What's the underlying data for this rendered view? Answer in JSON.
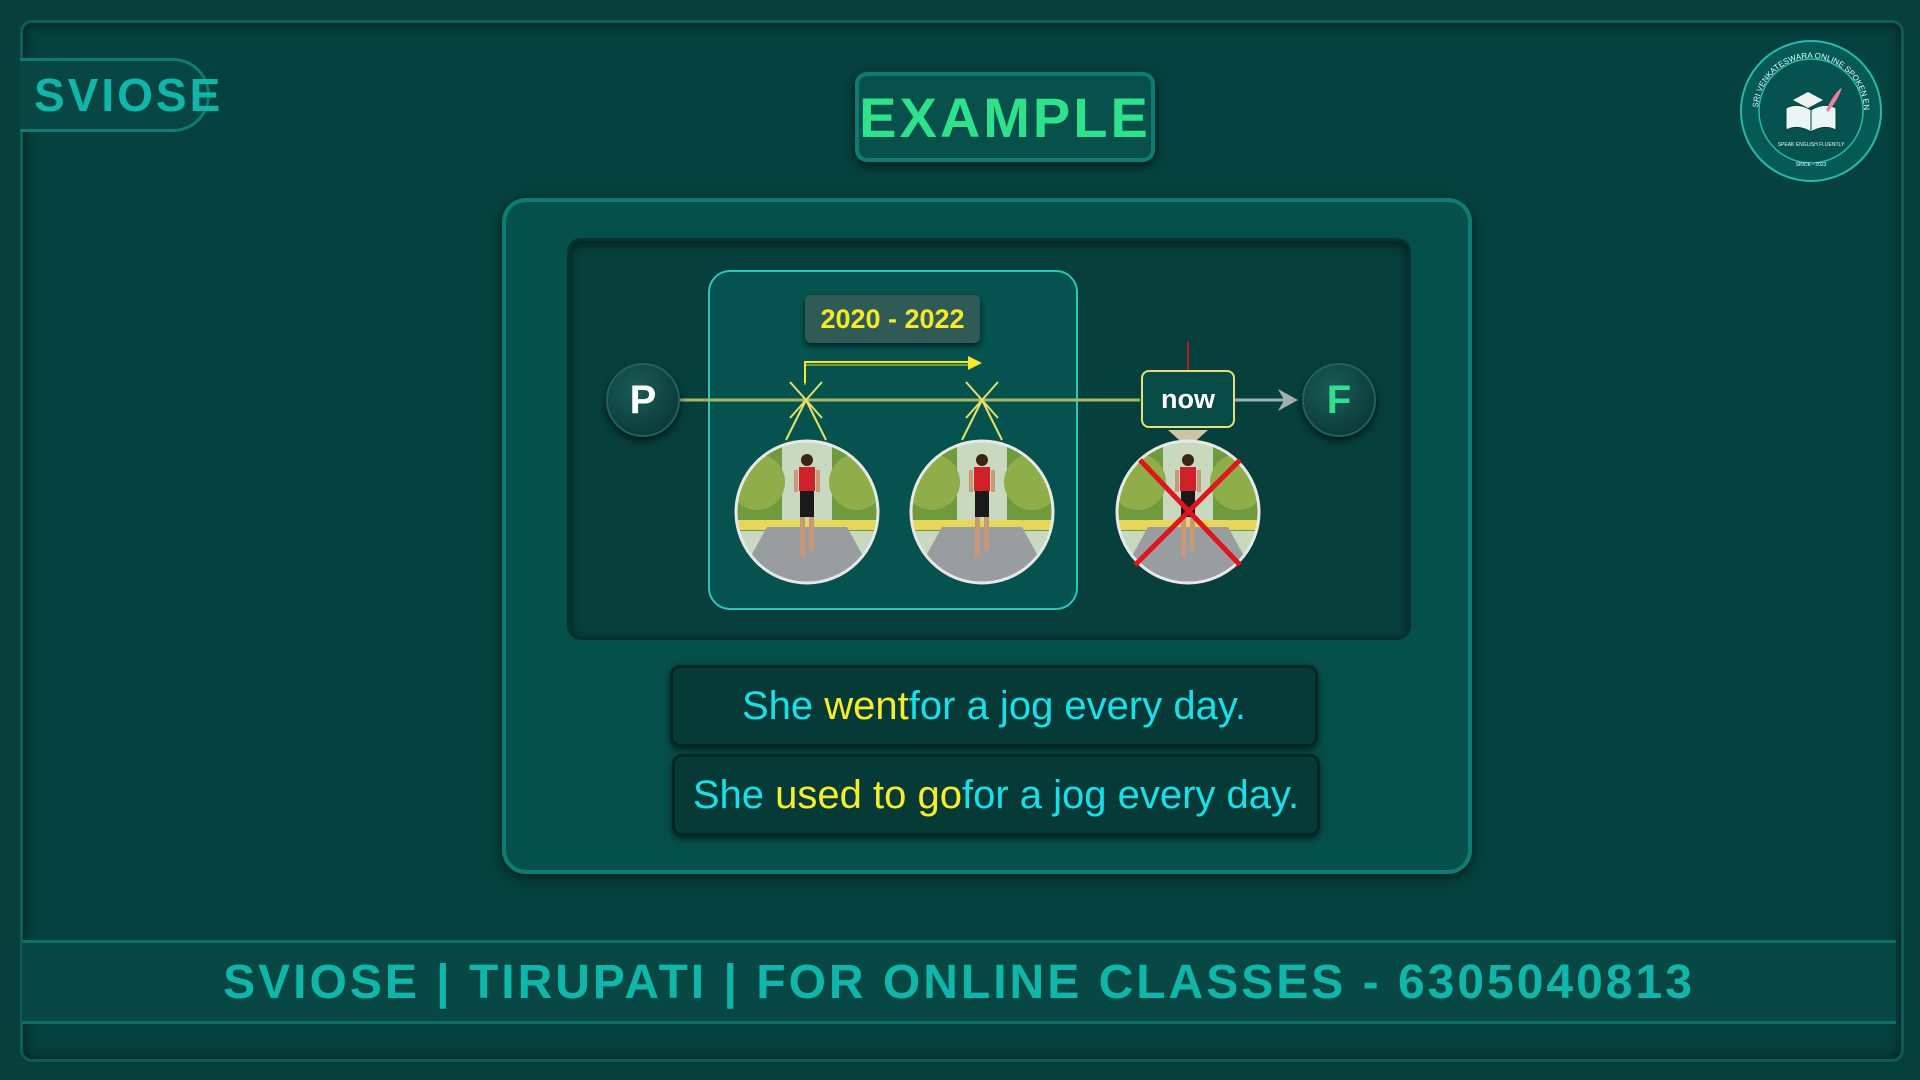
{
  "brand": {
    "tab_label": "SVIOSE"
  },
  "slide": {
    "title": "EXAMPLE"
  },
  "logo": {
    "ring_text": "SRI VENKATESWARA ONLINE SPOKEN ENGLISH SCHOOL",
    "motto": "SPEAK ENGLISH FLUENTLY",
    "since": "SINCE - 2023"
  },
  "timeline": {
    "start_label": "P",
    "end_label": "F",
    "range_label": "2020 - 2022",
    "now_label": "now"
  },
  "sentences": {
    "first": {
      "part1": "She ",
      "highlight": "went",
      "part2": " for a jog every day."
    },
    "second": {
      "part1": "She ",
      "highlight": "used to go",
      "part2": " for a jog every day."
    }
  },
  "footer": {
    "text": "SVIOSE | TIRUPATI | FOR ONLINE CLASSES - 6305040813"
  },
  "colors": {
    "background": "#063f3c",
    "accent_teal": "#10b6aa",
    "accent_green": "#2ee18a",
    "highlight_yellow": "#f6ee2a",
    "sentence_cyan": "#18e0ea",
    "cross_red": "#e0141c"
  },
  "icons": {
    "logo": "graduation-cap-book-icon",
    "jogger_images": [
      "jogger-photo",
      "jogger-photo",
      "jogger-photo-crossed"
    ]
  }
}
